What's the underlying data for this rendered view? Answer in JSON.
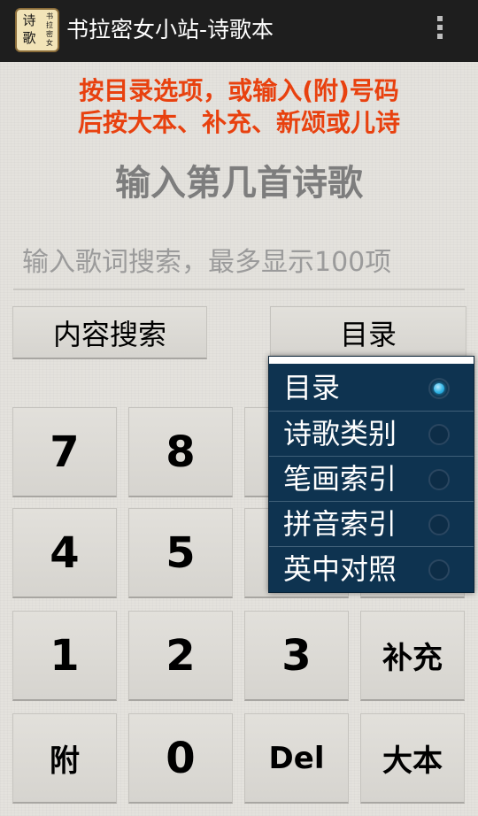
{
  "app": {
    "title": "书拉密女小站-诗歌本",
    "icon_big": "诗歌",
    "icon_small": "书拉密女"
  },
  "instruction": {
    "line1": "按目录选项，或输入(附)号码",
    "line2": "后按大本、补充、新颂或儿诗"
  },
  "prompt": "输入第几首诗歌",
  "search": {
    "placeholder": "输入歌词搜索，最多显示100项",
    "value": ""
  },
  "buttons": {
    "content_search": "内容搜索",
    "catalog": "目录"
  },
  "dropdown": {
    "selected": "目录",
    "options": [
      "目录",
      "诗歌类别",
      "笔画索引",
      "拼音索引",
      "英中对照"
    ]
  },
  "keypad": {
    "keys": [
      "7",
      "8",
      "4",
      "5",
      "1",
      "2",
      "3",
      "补充",
      "附",
      "0",
      "Del",
      "大本"
    ]
  },
  "colors": {
    "instruction": "#e8410f",
    "actionbar": "#1e1e1e",
    "dropdown_bg": "#0e3350",
    "radio_selected": "#33b5e5"
  },
  "icons": {
    "overflow": "overflow-menu-icon",
    "app": "app-icon"
  }
}
